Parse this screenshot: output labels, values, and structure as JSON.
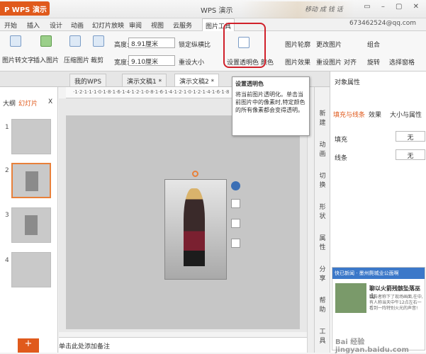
{
  "title_bar": {
    "app_button": "P  WPS 演示",
    "window_title": "WPS 演示",
    "cursive_text": "移动 成 钱 话"
  },
  "menu": {
    "tabs": [
      "开始",
      "插入",
      "设计",
      "动画",
      "幻灯片放映",
      "审阅",
      "视图",
      "云服务",
      "图片工具"
    ],
    "user": "673462524@qq.com"
  },
  "ribbon": {
    "img_to_text": "图片转文字",
    "insert_image": "插入图片",
    "compress": "压缩图片",
    "crop": "裁剪",
    "height_label": "高度:",
    "height_value": "8.91厘米",
    "width_label": "宽度:",
    "width_value": "9.10厘米",
    "lock_ratio": "锁定纵横比",
    "reset_size": "重设大小",
    "set_transparent": "设置透明色",
    "color": "颜色",
    "outline": "图片轮廓",
    "effects": "图片效果",
    "change_image": "更改图片",
    "reset_image": "重设图片",
    "align": "对齐",
    "rotate": "旋转",
    "group": "组合",
    "selection_pane": "选择窗格"
  },
  "tabs": {
    "doc_tabs": [
      "我的WPS",
      "演示文稿1 *",
      "演示文稿2 *"
    ],
    "find_command": "查找命令"
  },
  "left_panel": {
    "outline_tab": "大纲",
    "slides_tab": "幻灯片",
    "close": "X",
    "slide_numbers": [
      "1",
      "2",
      "3",
      "4"
    ],
    "add": "+"
  },
  "ruler": "·1·2·1·1·1·0·1·8·1·6·1·4·1·2·1·0·8·1·6·1·4·1·2·1·0·1·2·1·4·1·6·1·8",
  "notes_placeholder": "单击此处添加备注",
  "task_buttons": [
    "新建",
    "动画",
    "切换",
    "形状",
    "属性",
    "分享",
    "帮助",
    "工具"
  ],
  "right_panel": {
    "title": "对象属性",
    "tabs": [
      "填充与线条",
      "效果",
      "大小与属性",
      "图片"
    ],
    "fill_label": "填充",
    "fill_value": "无",
    "line_label": "线条",
    "line_value": "无",
    "news_header": "快已新闻 · 墨州爬城业公面啊",
    "news_title": "聊以火箭残骸坠落巫山",
    "news_body": "目击者称下了现场画面,在中,有人称当天中午12点左右一看到一阵特别火光的声音!",
    "watermark": "Bai 经验 jingyan.baidu.com"
  },
  "tooltip": {
    "title": "设置透明色",
    "body": "将当前图片透明化。单击当前图片中的像素时,特定颜色的所有像素都会变得透明。"
  },
  "colors": {
    "accent": "#e05a1c",
    "highlight": "#d0202a",
    "selection": "#e8803a"
  }
}
